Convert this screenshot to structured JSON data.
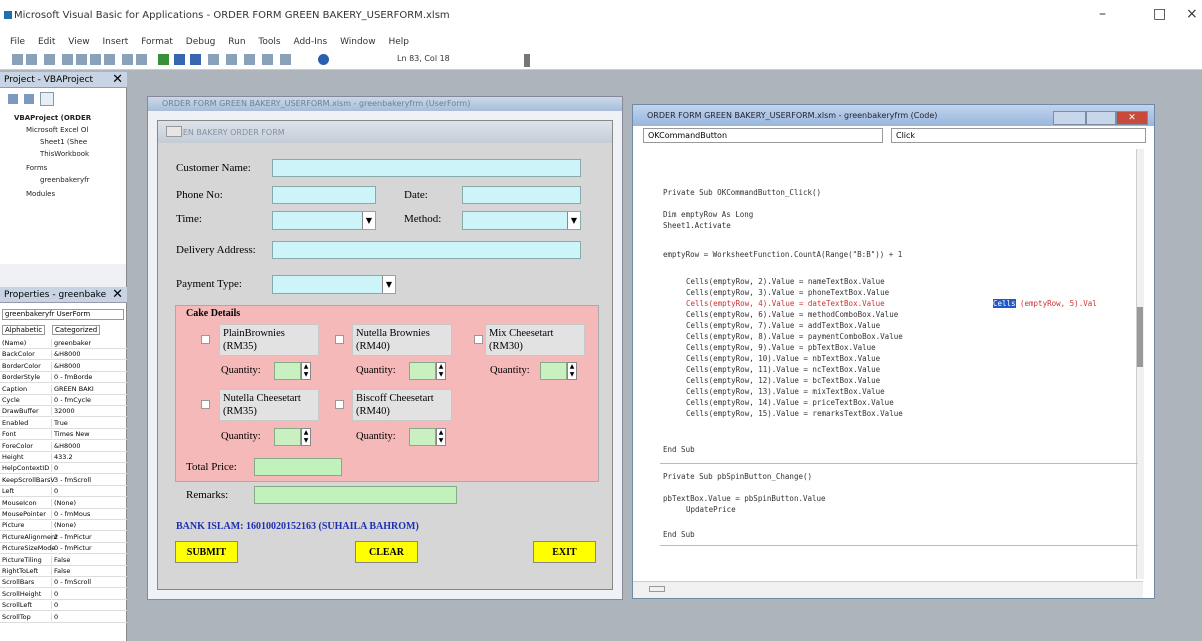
{
  "app": {
    "title": "Microsoft Visual Basic for Applications - ORDER FORM GREEN BAKERY_USERFORM.xlsm",
    "window_controls": [
      "–",
      "□",
      "×"
    ]
  },
  "menu": [
    "File",
    "Edit",
    "View",
    "Insert",
    "Format",
    "Debug",
    "Run",
    "Tools",
    "Add-Ins",
    "Window",
    "Help"
  ],
  "toolbar": {
    "position": "Ln 83, Col 18"
  },
  "project": {
    "header": "Project - VBAProject",
    "nodes": [
      "VBAProject (ORDER",
      "Microsoft Excel Ol",
      "Sheet1 (Shee",
      "ThisWorkbook",
      "Forms",
      "greenbakeryfr",
      "Modules"
    ]
  },
  "properties": {
    "header": "Properties - greenbake",
    "object": "greenbakeryfr UserForm",
    "tabs": [
      "Alphabetic",
      "Categorized"
    ],
    "rows": [
      [
        "(Name)",
        "greenbaker"
      ],
      [
        "BackColor",
        "&H8000"
      ],
      [
        "BorderColor",
        "&H8000"
      ],
      [
        "BorderStyle",
        "0 - fmBorde"
      ],
      [
        "Caption",
        "GREEN BAKI"
      ],
      [
        "Cycle",
        "0 - fmCycle"
      ],
      [
        "DrawBuffer",
        "32000"
      ],
      [
        "Enabled",
        "True"
      ],
      [
        "Font",
        "Times New"
      ],
      [
        "ForeColor",
        "&H8000"
      ],
      [
        "Height",
        "433.2"
      ],
      [
        "HelpContextID",
        "0"
      ],
      [
        "KeepScrollBarsV",
        "3 - fmScroll"
      ],
      [
        "Left",
        "0"
      ],
      [
        "MouseIcon",
        "(None)"
      ],
      [
        "MousePointer",
        "0 - fmMous"
      ],
      [
        "Picture",
        "(None)"
      ],
      [
        "PictureAlignment",
        "2 - fmPictur"
      ],
      [
        "PictureSizeMode",
        "0 - fmPictur"
      ],
      [
        "PictureTiling",
        "False"
      ],
      [
        "RightToLeft",
        "False"
      ],
      [
        "ScrollBars",
        "0 - fmScroll"
      ],
      [
        "ScrollHeight",
        "0"
      ],
      [
        "ScrollLeft",
        "0"
      ],
      [
        "ScrollTop",
        "0"
      ]
    ]
  },
  "form_window": {
    "caption": "ORDER FORM GREEN BAKERY_USERFORM.xlsm - greenbakeryfrm (UserForm)"
  },
  "userform": {
    "caption": "GREEN BAKERY ORDER FORM",
    "customer_name": "Customer Name:",
    "phone": "Phone No:",
    "date": "Date:",
    "time": "Time:",
    "method": "Method:",
    "address": "Delivery Address:",
    "payment": "Payment Type:",
    "cake_frame": "Cake Details",
    "cakes": [
      {
        "name": "PlainBrownies (RM35)"
      },
      {
        "name": "Nutella Brownies (RM40)"
      },
      {
        "name": "Mix Cheesetart (RM30)"
      },
      {
        "name": "Nutella Cheesetart (RM35)"
      },
      {
        "name": "Biscoff Cheesetart (RM40)"
      }
    ],
    "quantity": "Quantity:",
    "total": "Total Price:",
    "remarks": "Remarks:",
    "bank": "BANK ISLAM: 16010020152163 (SUHAILA BAHROM)",
    "submit": "SUBMIT",
    "clear": "CLEAR",
    "exit": "EXIT"
  },
  "code_window": {
    "caption": "ORDER FORM GREEN BAKERY_USERFORM.xlsm - greenbakeryfrm (Code)",
    "object": "OKCommandButton",
    "procedure": "Click",
    "lines": [
      "Private Sub OKCommandButton_Click()",
      "Dim emptyRow As Long",
      "Sheet1.Activate",
      "emptyRow = WorksheetFunction.CountA(Range(\"B:B\")) + 1",
      "Cells(emptyRow, 2).Value = nameTextBox.Value",
      "Cells(emptyRow, 3).Value = phoneTextBox.Value",
      "Cells(emptyRow, 4).Value = dateTextBox.Value",
      "Cells(emptyRow, 6).Value = methodComboBox.Value",
      "Cells(emptyRow, 7).Value = addTextBox.Value",
      "Cells(emptyRow, 8).Value = paymentComboBox.Value",
      "Cells(emptyRow, 9).Value = pbTextBox.Value",
      "Cells(emptyRow, 10).Value = nbTextBox.Value",
      "Cells(emptyRow, 11).Value = ncTextBox.Value",
      "Cells(emptyRow, 12).Value = bcTextBox.Value",
      "Cells(emptyRow, 13).Value = mixTextBox.Value",
      "Cells(emptyRow, 14).Value = priceTextBox.Value",
      "Cells(emptyRow, 15).Value = remarksTextBox.Value",
      "End Sub",
      "Private Sub pbSpinButton_Change()",
      "pbTextBox.Value = pbSpinButton.Value",
      "UpdatePrice",
      "End Sub"
    ],
    "selected_word": "Cells",
    "line4_tail": "(emptyRow, 5).Val"
  }
}
